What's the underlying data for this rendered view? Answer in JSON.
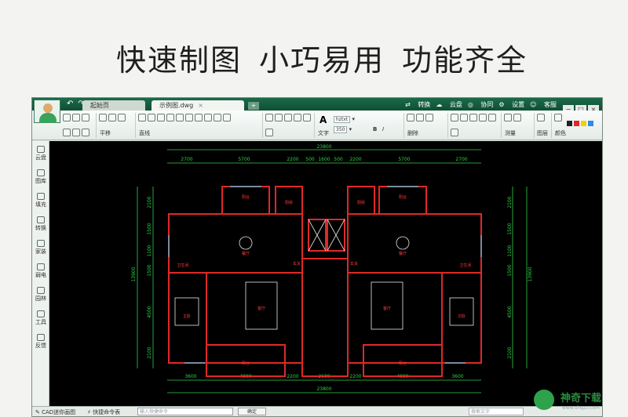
{
  "promo": {
    "phrases": [
      "快速制图",
      "小巧易用",
      "功能齐全"
    ]
  },
  "titlebar": {
    "tabs": [
      {
        "label": "起始页",
        "active": false
      },
      {
        "label": "示例图.dwg",
        "active": true
      }
    ],
    "actions": [
      "转换",
      "云盘",
      "协同",
      "设置",
      "客服"
    ],
    "window_controls": [
      "−",
      "□",
      "×"
    ]
  },
  "toolbar": {
    "groups": [
      {
        "label": "平移"
      },
      {
        "label": "直线"
      },
      {
        "label": "文字"
      },
      {
        "label": "删除"
      },
      {
        "label": "测量"
      },
      {
        "label": "图层"
      },
      {
        "label": "颜色"
      }
    ],
    "font_name": "hztxt",
    "font_size": "350",
    "bold": "B",
    "italic": "I",
    "text_icon": "A"
  },
  "sidebar": {
    "items": [
      "云盘",
      "图库",
      "填充",
      "转换",
      "家装",
      "弱电",
      "园林",
      "工具",
      "反馈"
    ]
  },
  "drawing": {
    "top_total": "23800",
    "top_dims": [
      "2700",
      "5700",
      "2200",
      "500",
      "1600",
      "500",
      "2200",
      "5700",
      "2700"
    ],
    "bottom_total": "23800",
    "bottom_dims": [
      "3600",
      "4800",
      "2200",
      "2600",
      "2200",
      "4800",
      "3600"
    ],
    "left_total": "13900",
    "left_dims": [
      "2100",
      "1500",
      "1100",
      "1500",
      "4500",
      "2100"
    ],
    "right_total": "13900",
    "right_dims": [
      "2100",
      "1500",
      "1100",
      "1500",
      "4500",
      "2100"
    ],
    "room_labels": [
      "阳台",
      "厨房",
      "厨房",
      "阳台",
      "餐厅",
      "餐厅",
      "卫生间",
      "卫生间",
      "主卧",
      "客厅",
      "客厅",
      "次卧",
      "阳台",
      "阳台",
      "玄关",
      "玄关"
    ]
  },
  "colors": {
    "titlebar": "#14603f",
    "canvas_bg": "#000000",
    "wall": "#e02828",
    "dimension": "#30d14a",
    "window": "#3fc6e8",
    "furniture": "#e8e8e8",
    "room_text": "#ff3b3b"
  },
  "statusbar": {
    "app_label": "CAD迷你画图",
    "cmd_label": "快捷命令表",
    "cmd_placeholder": "输入快捷命令",
    "ok_label": "确定",
    "search_placeholder": "搜索文字"
  },
  "watermark": {
    "text": "神奇下载",
    "url": "www.shqzz.com"
  }
}
